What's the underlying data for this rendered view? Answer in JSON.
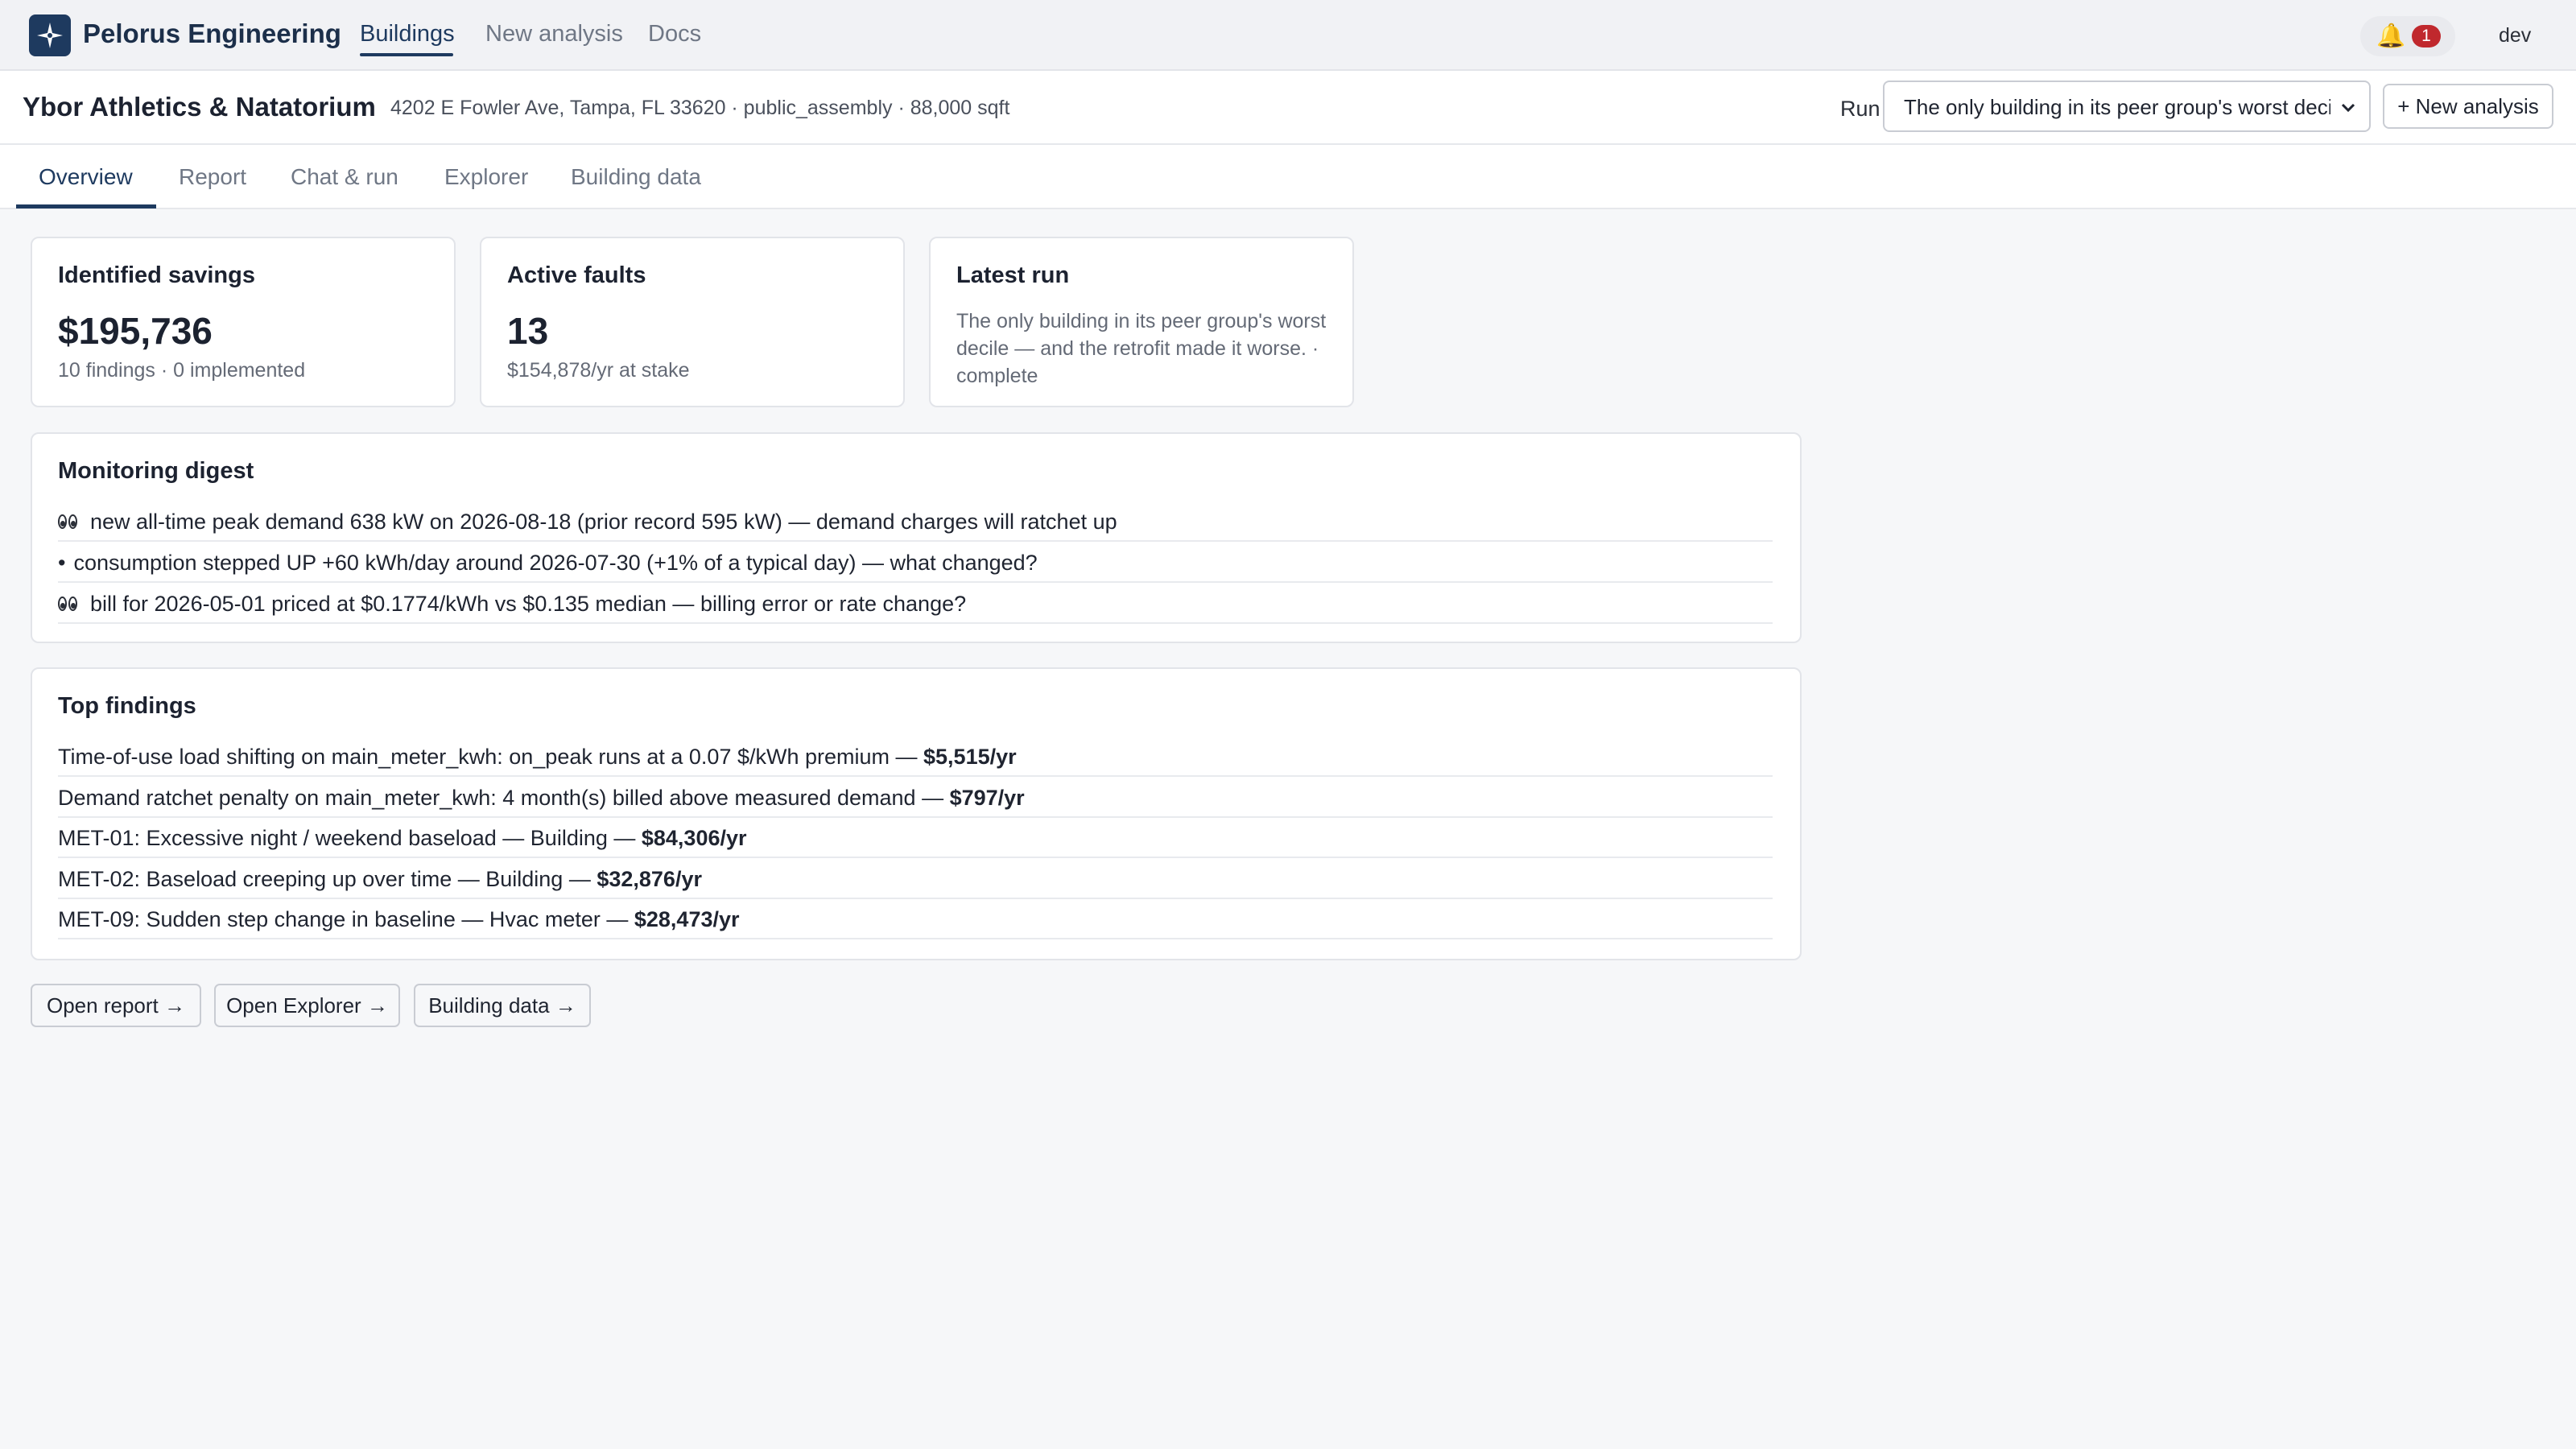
{
  "app": {
    "brand": "Pelorus Engineering",
    "nav": [
      {
        "label": "Buildings",
        "active": true
      },
      {
        "label": "New analysis",
        "active": false
      },
      {
        "label": "Docs",
        "active": false
      }
    ],
    "notifications": {
      "icon": "bell-icon",
      "count": "1"
    },
    "user": "dev"
  },
  "building": {
    "name": "Ybor Athletics & Natatorium",
    "meta": "4202 E Fowler Ave, Tampa, FL 33620 · public_assembly · 88,000 sqft",
    "run_label": "Run",
    "run_selected": "The only building in its peer group's worst decile — and the retrofit made it worse.",
    "new_analysis_label": "+ New analysis"
  },
  "tabs": [
    {
      "label": "Overview",
      "active": true
    },
    {
      "label": "Report",
      "active": false
    },
    {
      "label": "Chat & run",
      "active": false
    },
    {
      "label": "Explorer",
      "active": false
    },
    {
      "label": "Building data",
      "active": false
    }
  ],
  "summary": {
    "savings": {
      "title": "Identified savings",
      "value": "$195,736",
      "sub": "10 findings · 0 implemented"
    },
    "faults": {
      "title": "Active faults",
      "value": "13",
      "sub": "$154,878/yr at stake"
    },
    "latest_run": {
      "title": "Latest run",
      "text": "The only building in its peer group's worst decile — and the retrofit made it worse. · complete"
    }
  },
  "digest": {
    "title": "Monitoring digest",
    "items": [
      {
        "icon": "eyes-icon",
        "text": "new all-time peak demand 638 kW on 2026-08-18 (prior record 595 kW) — demand charges will ratchet up"
      },
      {
        "icon": "bullet",
        "bullet": "•",
        "text": "consumption stepped UP +60 kWh/day around 2026-07-30 (+1% of a typical day) — what changed?"
      },
      {
        "icon": "eyes-icon",
        "text": "bill for 2026-05-01 priced at $0.1774/kWh vs $0.135 median — billing error or rate change?"
      }
    ]
  },
  "findings": {
    "title": "Top findings",
    "items": [
      {
        "text": "Time-of-use load shifting on main_meter_kwh: on_peak runs at a 0.07 $/kWh premium — ",
        "amount": "$5,515/yr"
      },
      {
        "text": "Demand ratchet penalty on main_meter_kwh: 4 month(s) billed above measured demand — ",
        "amount": "$797/yr"
      },
      {
        "text": "MET-01: Excessive night / weekend baseload — Building — ",
        "amount": "$84,306/yr"
      },
      {
        "text": "MET-02: Baseload creeping up over time — Building — ",
        "amount": "$32,876/yr"
      },
      {
        "text": "MET-09: Sudden step change in baseline — Hvac meter — ",
        "amount": "$28,473/yr"
      }
    ]
  },
  "actions": {
    "open_report": "Open report →",
    "open_explorer": "Open Explorer →",
    "building_data": "Building data →"
  },
  "colors": {
    "brand": "#1e3a5f",
    "badge": "#c0282d",
    "bell": "#e0a100"
  }
}
